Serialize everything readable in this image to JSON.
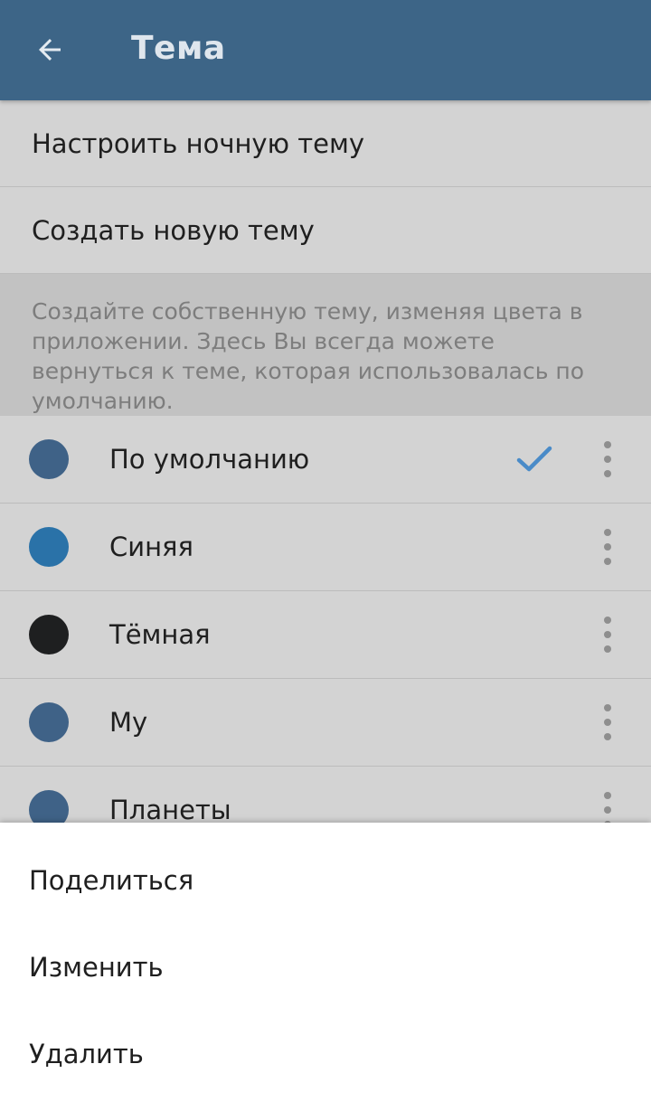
{
  "header": {
    "title": "Тема",
    "back_icon": "arrow-left-icon"
  },
  "menu": {
    "night_theme": "Настроить ночную тему",
    "create_theme": "Создать новую тему"
  },
  "info": {
    "text": "Создайте собственную тему, изменяя цвета в приложении. Здесь Вы всегда можете вернуться к теме, которая использовалась по умолчанию."
  },
  "themes": [
    {
      "name": "По умолчанию",
      "color": "#3f6287",
      "selected": true
    },
    {
      "name": "Синяя",
      "color": "#2a72a8",
      "selected": false
    },
    {
      "name": "Тёмная",
      "color": "#1e1f20",
      "selected": false
    },
    {
      "name": "My",
      "color": "#3f6287",
      "selected": false
    },
    {
      "name": "Планеты",
      "color": "#3f6287",
      "selected": false
    }
  ],
  "sheet": {
    "share": "Поделиться",
    "edit": "Изменить",
    "delete": "Удалить"
  },
  "colors": {
    "header_bg": "#3d6587",
    "accent_check": "#4a8bc8"
  }
}
